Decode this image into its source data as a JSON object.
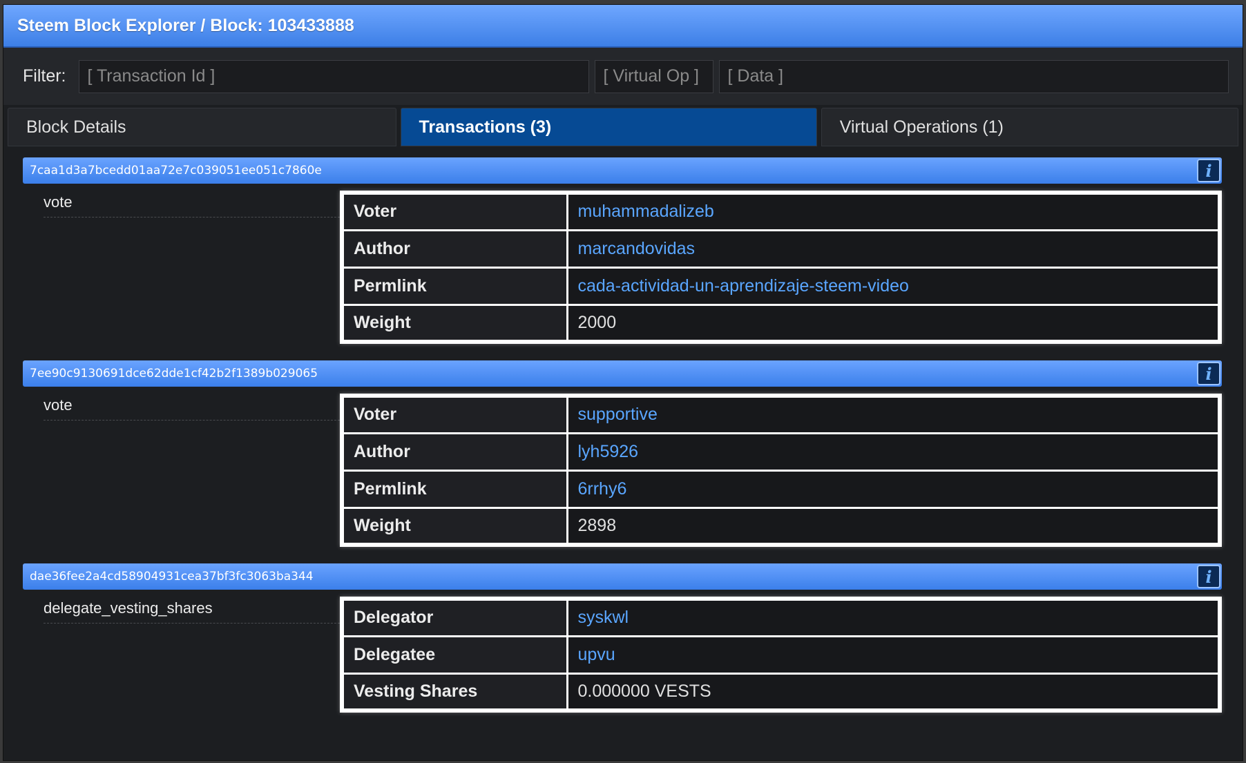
{
  "title": "Steem Block Explorer / Block: 103433888",
  "filter": {
    "label": "Filter:",
    "transaction_id_placeholder": "[ Transaction Id ]",
    "virtual_op_placeholder": "[ Virtual Op ]",
    "data_placeholder": "[ Data ]"
  },
  "tabs": [
    {
      "label": "Block Details",
      "active": false
    },
    {
      "label": "Transactions (3)",
      "active": true
    },
    {
      "label": "Virtual Operations (1)",
      "active": false
    }
  ],
  "transactions": [
    {
      "id": "7caa1d3a7bcedd01aa72e7c039051ee051c7860e",
      "op": "vote",
      "fields": [
        {
          "key": "Voter",
          "value": "muhammadalizeb",
          "link": true
        },
        {
          "key": "Author",
          "value": "marcandovidas",
          "link": true
        },
        {
          "key": "Permlink",
          "value": "cada-actividad-un-aprendizaje-steem-video",
          "link": true
        },
        {
          "key": "Weight",
          "value": "2000",
          "link": false
        }
      ]
    },
    {
      "id": "7ee90c9130691dce62dde1cf42b2f1389b029065",
      "op": "vote",
      "fields": [
        {
          "key": "Voter",
          "value": "supportive",
          "link": true
        },
        {
          "key": "Author",
          "value": "lyh5926",
          "link": true
        },
        {
          "key": "Permlink",
          "value": "6rrhy6",
          "link": true
        },
        {
          "key": "Weight",
          "value": "2898",
          "link": false
        }
      ]
    },
    {
      "id": "dae36fee2a4cd58904931cea37bf3fc3063ba344",
      "op": "delegate_vesting_shares",
      "fields": [
        {
          "key": "Delegator",
          "value": "syskwl",
          "link": true
        },
        {
          "key": "Delegatee",
          "value": "upvu",
          "link": true
        },
        {
          "key": "Vesting Shares",
          "value": "0.000000 VESTS",
          "link": false
        }
      ]
    }
  ],
  "icons": {
    "info": "info-icon"
  },
  "colors": {
    "accent": "#3d7fe6",
    "active_tab": "#064a94",
    "link": "#5aa6ff"
  }
}
